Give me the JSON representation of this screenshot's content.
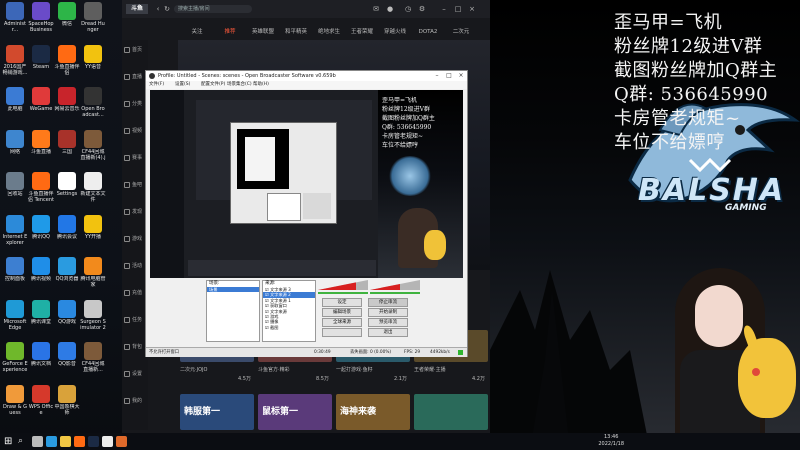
{
  "desktop": {
    "icons": [
      {
        "label": "Administr...",
        "color": "#3c67b8"
      },
      {
        "label": "SpaceHop Business",
        "color": "#6a4bc9"
      },
      {
        "label": "微信",
        "color": "#2db548"
      },
      {
        "label": "Dread Hunger",
        "color": "#5e5e5e"
      },
      {
        "label": "2016国产畅销游戏...",
        "color": "#d24a2d"
      },
      {
        "label": "Steam",
        "color": "#1b2a44"
      },
      {
        "label": "斗鱼直播伴侣",
        "color": "#ff6a13"
      },
      {
        "label": "YY语音",
        "color": "#f2c20f"
      },
      {
        "label": "此电脑",
        "color": "#3b7bd4"
      },
      {
        "label": "WeGame",
        "color": "#e03a3a"
      },
      {
        "label": "网易云音乐",
        "color": "#c8242b"
      },
      {
        "label": "Open Broadcast...",
        "color": "#333333"
      },
      {
        "label": "网络",
        "color": "#3e86cf"
      },
      {
        "label": "斗鱼直播",
        "color": "#ff7a1a"
      },
      {
        "label": "三国",
        "color": "#a8322a"
      },
      {
        "label": "CF44回城直播新(4).jpg",
        "color": "#7d5a3a"
      },
      {
        "label": "回收站",
        "color": "#6b7c8c"
      },
      {
        "label": "斗鱼直播伴侣 Tencent Bro...",
        "color": "#ff6a13"
      },
      {
        "label": "Settings",
        "color": "#ffffff"
      },
      {
        "label": "新建文本文件",
        "color": "#eeeeee"
      },
      {
        "label": "Internet Explorer",
        "color": "#2c8ad9"
      },
      {
        "label": "腾讯QQ",
        "color": "#1f9ae8"
      },
      {
        "label": "腾讯会议",
        "color": "#2277e6"
      },
      {
        "label": "YY开播",
        "color": "#f2c20f"
      },
      {
        "label": "控制面板",
        "color": "#3d7fd1"
      },
      {
        "label": "腾讯视频",
        "color": "#1f8ee8"
      },
      {
        "label": "QQ浏览器",
        "color": "#2a9be0"
      },
      {
        "label": "腾讯电脑管家",
        "color": "#f28a1c"
      },
      {
        "label": "Microsoft Edge",
        "color": "#1f9ad6"
      },
      {
        "label": "腾讯课堂",
        "color": "#1fb0a5"
      },
      {
        "label": "QQ游戏",
        "color": "#2a89e0"
      },
      {
        "label": "Surgeon Simulator 2",
        "color": "#c8c8c8"
      },
      {
        "label": "GeForce Experience",
        "color": "#6fb82b"
      },
      {
        "label": "腾讯文档",
        "color": "#2a74e6"
      },
      {
        "label": "QQ影音",
        "color": "#2e7be5"
      },
      {
        "label": "CF44回城直播新...",
        "color": "#7d5a3a"
      },
      {
        "label": "Draw & Guess",
        "color": "#f09a3a"
      },
      {
        "label": "WPS Office",
        "color": "#d6392b"
      },
      {
        "label": "中国象棋大师",
        "color": "#d9a23a"
      }
    ]
  },
  "player": {
    "logo": "斗鱼",
    "search_placeholder": "搜索主播/房间",
    "tabs": [
      "关注",
      "推荐",
      "英雄联盟",
      "和平精英",
      "绝地求生",
      "王者荣耀",
      "穿越火线",
      "DOTA2",
      "二次元"
    ],
    "active_tab": "推荐",
    "sidebar": [
      "首页",
      "直播",
      "分类",
      "视频",
      "赛事",
      "鱼吧",
      "发现",
      "游戏",
      "活动",
      "充值",
      "任务",
      "背包",
      "设置",
      "我的"
    ],
    "bottom_cards": [
      {
        "caption": "二次元·JOJO",
        "count": "4.5万"
      },
      {
        "caption": "斗鱼官方·精彩",
        "count": "8.5万"
      },
      {
        "caption": "一起打游戏·鱼籽",
        "count": "2.1万"
      },
      {
        "caption": "王者荣耀·主播",
        "count": "4.2万"
      }
    ],
    "thumb_texts": [
      "韩服第一",
      "鼠标第一",
      "海神来袭"
    ]
  },
  "obs": {
    "title": "Profile: Untitled - Scenes: scenes - Open Broadcaster Software v0.659b",
    "menu": [
      "文件(F)",
      "设置(S)",
      "配置文件(P)",
      "场景集合(C)",
      "帮助(H)"
    ],
    "scenes_header": "场景:",
    "sources_header": "来源:",
    "scenes": [
      "场景"
    ],
    "sources": [
      {
        "label": "文字来源 3",
        "selected": false
      },
      {
        "label": "文字来源 2",
        "selected": true
      },
      {
        "label": "文字来源 1",
        "selected": false
      },
      {
        "label": "获取窗口",
        "selected": false
      },
      {
        "label": "文字来源",
        "selected": false
      },
      {
        "label": "游戏",
        "selected": false
      },
      {
        "label": "摄像",
        "selected": false
      },
      {
        "label": "截图",
        "selected": false
      }
    ],
    "buttons": [
      {
        "label": "设定",
        "style": "normal"
      },
      {
        "label": "停止串流",
        "style": "dark"
      },
      {
        "label": "编辑场景",
        "style": "normal"
      },
      {
        "label": "开始录制",
        "style": "normal"
      },
      {
        "label": "全球来源",
        "style": "normal"
      },
      {
        "label": "预览串流",
        "style": "normal"
      },
      {
        "label": "",
        "style": "normal"
      },
      {
        "label": "退出",
        "style": "normal"
      }
    ],
    "status": {
      "left": "不允许打开窗口",
      "time": "0:30:49",
      "dropped": "丢失画面: 0 (0.00%)",
      "fps": "FPS: 29",
      "kbps": "4492kb/s"
    },
    "preview_overlay": [
      "歪马甲=飞机",
      "粉丝牌12级进V群",
      "截图粉丝牌加Q群主",
      "Q群: 536645990",
      "卡房管老规矩~",
      "车位不给嫖哼"
    ]
  },
  "overlay": {
    "lines": [
      "歪马甲=飞机",
      "粉丝牌12级进V群",
      "截图粉丝牌加Q群主",
      "Q群:   536645990",
      "卡房管老规矩~",
      "车位不给嫖哼"
    ],
    "logo_text": "BALSHA",
    "logo_sub": "GAMING"
  },
  "taskbar": {
    "time": "13:46",
    "date": "2022/1/18",
    "icons": [
      {
        "name": "start",
        "color": "#ffffff"
      },
      {
        "name": "search",
        "color": "#cccccc"
      },
      {
        "name": "task-view",
        "color": "#bbbbbb"
      },
      {
        "name": "browser",
        "color": "#2a9be0"
      },
      {
        "name": "explorer",
        "color": "#f2c744"
      },
      {
        "name": "douyu",
        "color": "#ff6a13"
      },
      {
        "name": "steam",
        "color": "#1b2a44"
      },
      {
        "name": "obs",
        "color": "#ececec"
      },
      {
        "name": "player",
        "color": "#e06a2b"
      }
    ]
  }
}
